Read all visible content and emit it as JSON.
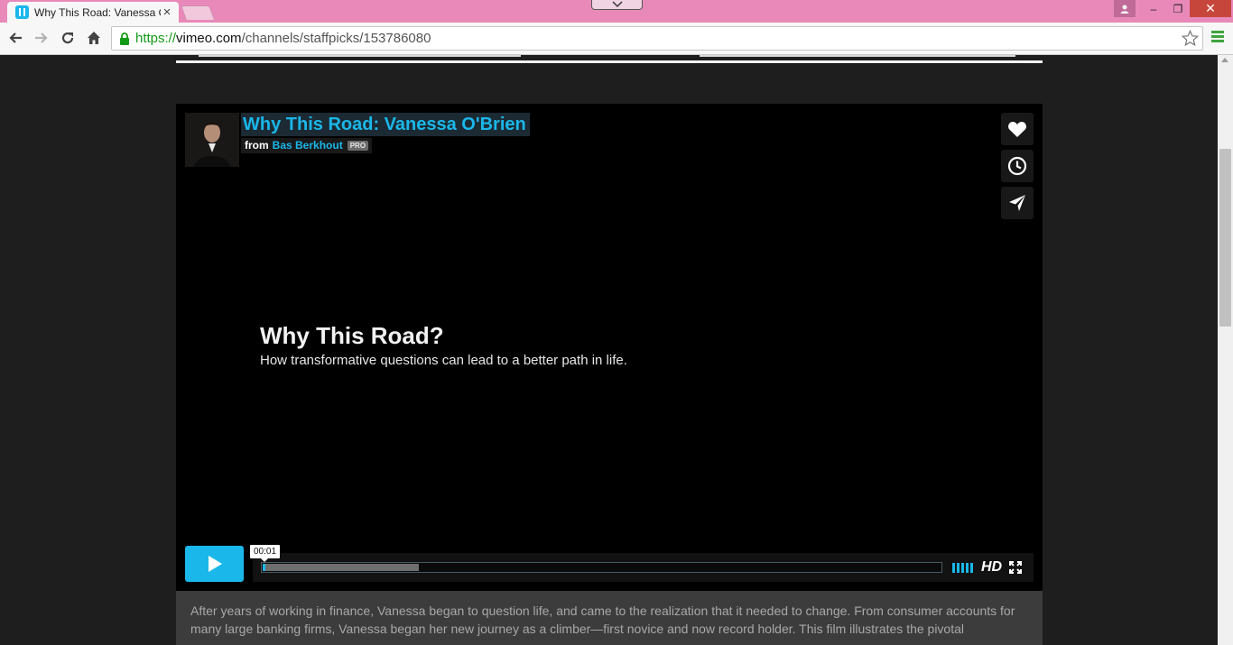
{
  "browser": {
    "tab": {
      "title": "Why This Road: Vanessa O",
      "close_glyph": "×"
    },
    "window_controls": {
      "minimize": "–",
      "maximize": "❐",
      "close": "✕"
    },
    "address": {
      "scheme": "https://",
      "host": "vimeo.com",
      "path": "/channels/staffpicks/153786080"
    }
  },
  "player": {
    "title": "Why This Road: Vanessa O'Brien",
    "byline_prefix": "from",
    "author": "Bas Berkhout",
    "badge": "PRO",
    "slide_heading": "Why This Road?",
    "slide_subtitle": "How transformative questions can lead to a better path in life.",
    "time": "00:01",
    "played_fraction": 0.004,
    "loaded_fraction": 0.23,
    "volume_bars": 5,
    "hd_label": "HD",
    "side_actions": [
      "like-icon",
      "watch-later-icon",
      "share-icon"
    ]
  },
  "description": {
    "text": "After years of working in finance, Vanessa began to question life, and came to the realization that it needed to change. From consumer accounts for many large banking firms, Vanessa began her new journey as a climber—first novice and now record holder. This film illustrates the pivotal"
  },
  "colors": {
    "accent": "#1ab7ea",
    "chrome": "#e889b9"
  }
}
